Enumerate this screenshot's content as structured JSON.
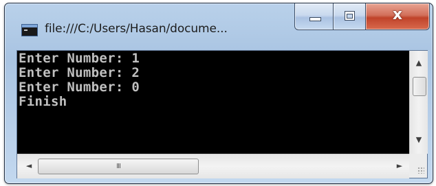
{
  "window": {
    "title": "file:///C:/Users/Hasan/docume...",
    "close_label": "x",
    "app_icon": "console-app-icon"
  },
  "console": {
    "lines": [
      "Enter Number: 1",
      "Enter Number: 2",
      "Enter Number: 0",
      "Finish"
    ]
  },
  "scrollbars": {
    "up_arrow": "▲",
    "down_arrow": "▼",
    "left_arrow": "◄",
    "right_arrow": "►",
    "h_thumb_grip": "III"
  },
  "colors": {
    "console_background": "#000000",
    "console_text": "#c0c0c0",
    "close_button": "#c7472c"
  }
}
